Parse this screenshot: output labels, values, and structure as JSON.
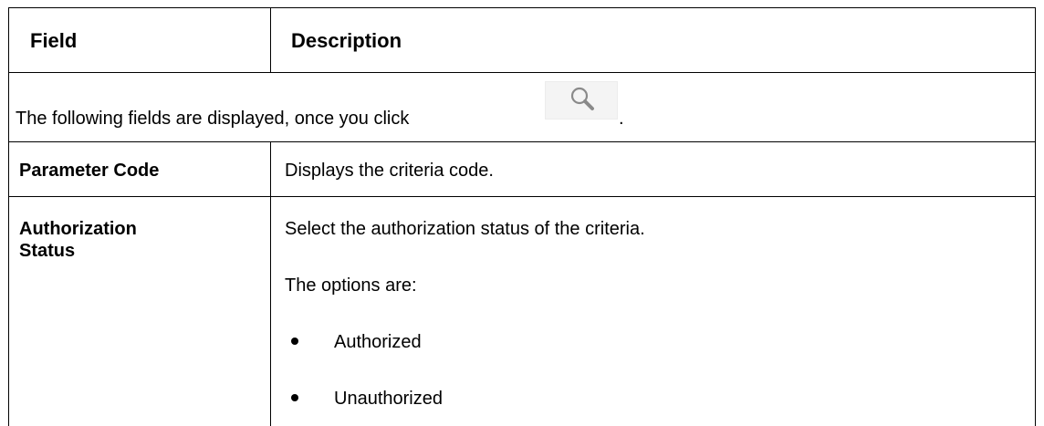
{
  "table": {
    "header": {
      "field": "Field",
      "description": "Description"
    },
    "intro": {
      "text": "The following fields are displayed, once you click",
      "suffix": ".",
      "icon": "search-icon"
    },
    "rows": [
      {
        "field": "Parameter Code",
        "description": "Displays the criteria code."
      },
      {
        "field_line1": "Authorization",
        "field_line2": "Status",
        "description": "Select the authorization status of the criteria.",
        "options_intro": "The options are:",
        "options": [
          "Authorized",
          "Unauthorized"
        ]
      }
    ]
  }
}
